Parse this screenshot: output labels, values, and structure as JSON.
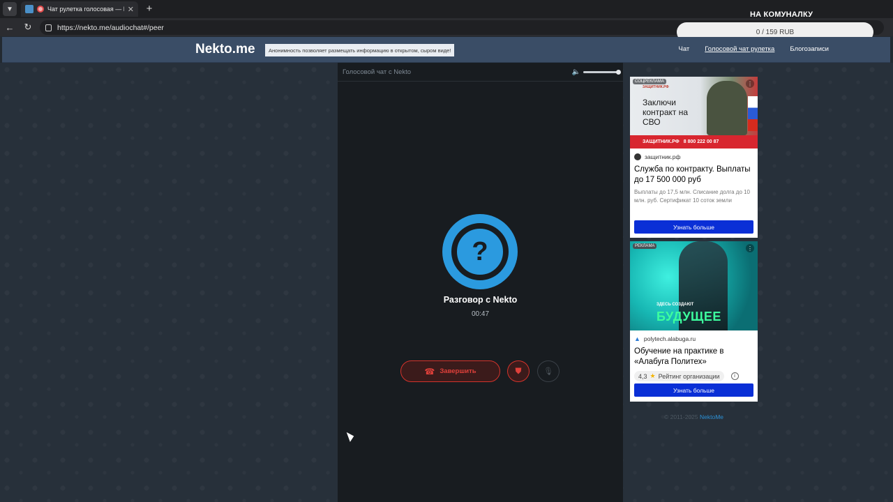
{
  "browser": {
    "tab_title": "Чат рулетка голосовая — N",
    "url": "https://nekto.me/audiochat#/peer"
  },
  "donation": {
    "title": "НА КОМУНАЛКУ",
    "value": "0 / 159 RUB"
  },
  "site": {
    "logo": "Nekto.me",
    "slogan": "Анонимность позволяет размещать информацию в открытом, сыром виде!",
    "nav": [
      "Чат",
      "Голосовой чат рулетка",
      "Блогозаписи"
    ]
  },
  "chat": {
    "header_title": "Голосовой чат с Nekto",
    "volume_level": 1.0,
    "peer_name": "Разговор с Nekto",
    "timer": "00:47",
    "end_label": "Завершить"
  },
  "ads": [
    {
      "tag": "СОЦРЕКЛАМА",
      "banner_brand": "ЗАЩИТНИК.РФ",
      "banner_head": "Заключи контракт на СВО",
      "banner_strip_brand": "ЗАЩИТНИК.РФ",
      "banner_strip_phone": "8 800 222 00 87",
      "domain": "защитник.рф",
      "title": "Служба по контракту. Выплаты до 17 500 000 руб",
      "desc": "Выплаты до 17,5 млн. Списание долга до 10 млн. руб. Сертификат 10 соток земли",
      "button": "Узнать больше"
    },
    {
      "tag": "РЕКЛАМА",
      "banner_small": "ЗДЕСЬ СОЗДАЮТ",
      "banner_big": "БУДУЩЕЕ",
      "domain": "polytech.alabuga.ru",
      "title": "Обучение на практике в «Алабуга Политех»",
      "rating": "4,3",
      "rating_label": "Рейтинг организации",
      "button": "Узнать больше"
    }
  ],
  "footer": {
    "copyright": "© 2011-2025",
    "link": "NektoMe"
  }
}
